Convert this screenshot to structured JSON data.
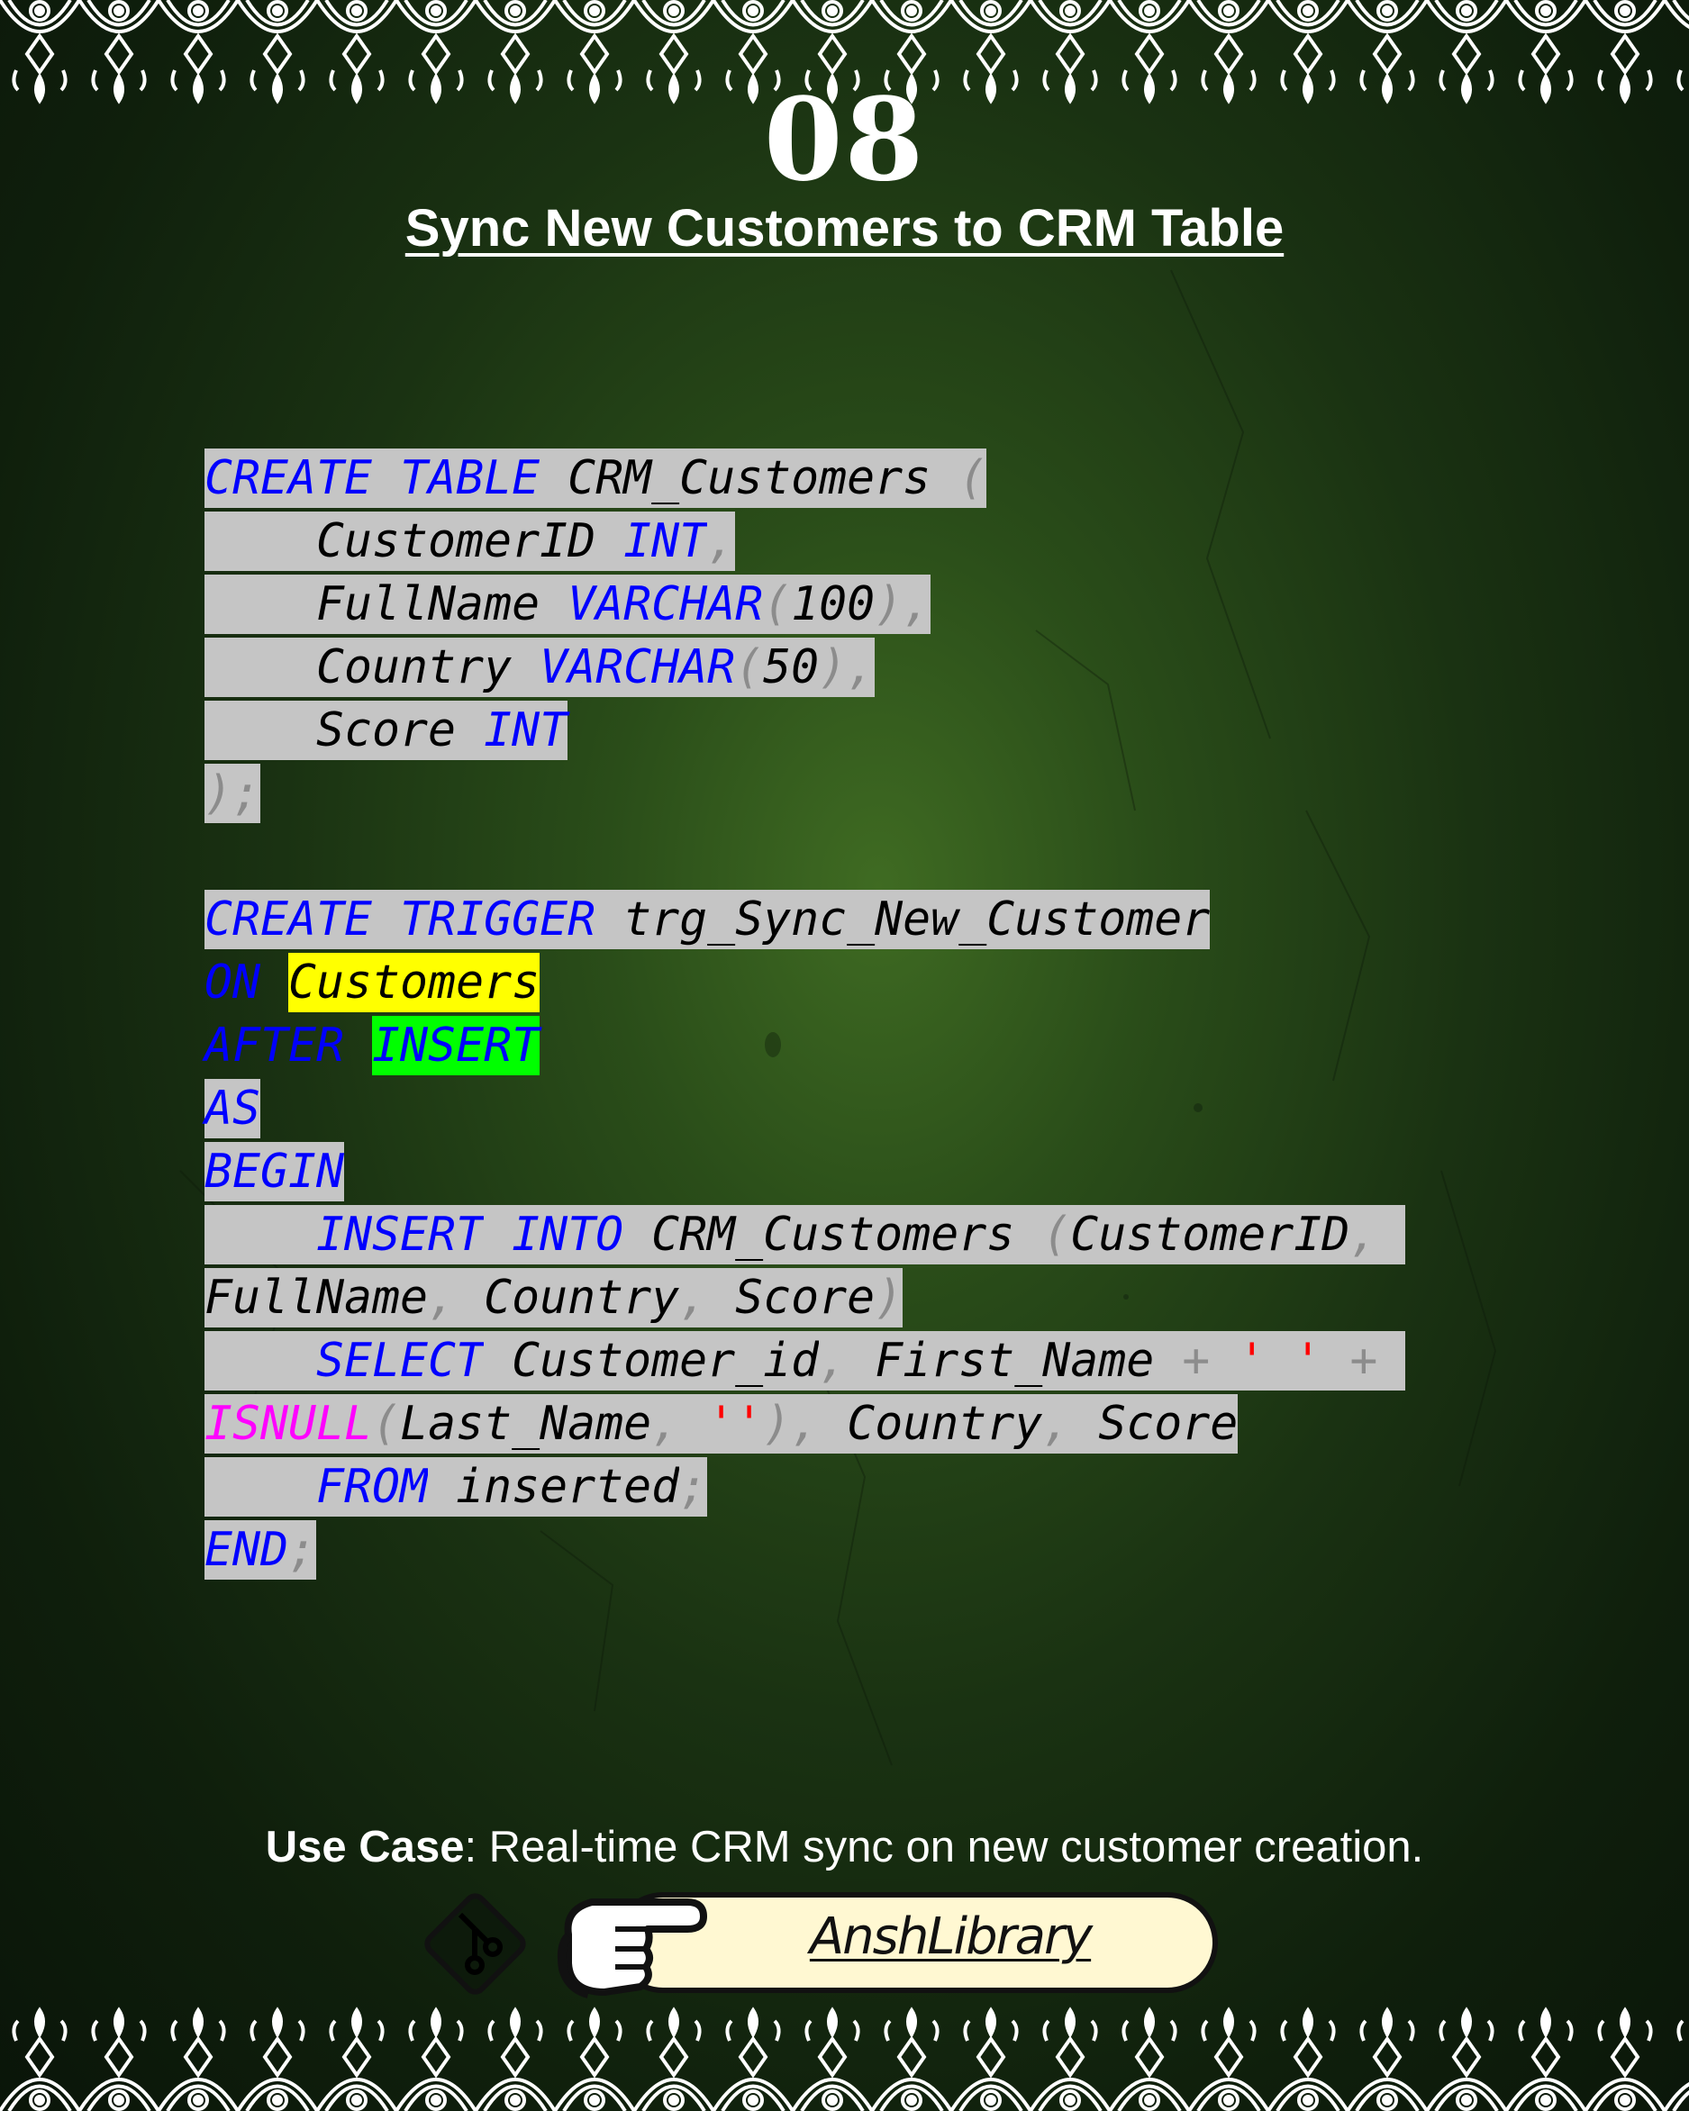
{
  "page_number": "08",
  "title": "Sync New Customers to CRM Table",
  "code_lines": [
    {
      "tokens": [
        [
          "kw",
          "CREATE",
          "bg"
        ],
        [
          "sp",
          " ",
          "bg"
        ],
        [
          "kw",
          "TABLE",
          "bg"
        ],
        [
          "sp",
          " ",
          "bg"
        ],
        [
          "id",
          "CRM_Customers",
          "bg"
        ],
        [
          "sp",
          " ",
          "bg"
        ],
        [
          "pn",
          "(",
          "bg"
        ]
      ]
    },
    {
      "tokens": [
        [
          "sp",
          "    ",
          "bg"
        ],
        [
          "id",
          "CustomerID",
          "bg"
        ],
        [
          "sp",
          " ",
          "bg"
        ],
        [
          "kw",
          "INT",
          "bg"
        ],
        [
          "pn",
          ",",
          "bg"
        ]
      ]
    },
    {
      "tokens": [
        [
          "sp",
          "    ",
          "bg"
        ],
        [
          "id",
          "FullName",
          "bg"
        ],
        [
          "sp",
          " ",
          "bg"
        ],
        [
          "kw",
          "VARCHAR",
          "bg"
        ],
        [
          "pn",
          "(",
          "bg"
        ],
        [
          "num",
          "100",
          "bg"
        ],
        [
          "pn",
          "),",
          "bg"
        ]
      ]
    },
    {
      "tokens": [
        [
          "sp",
          "    ",
          "bg"
        ],
        [
          "id",
          "Country",
          "bg"
        ],
        [
          "sp",
          " ",
          "bg"
        ],
        [
          "kw",
          "VARCHAR",
          "bg"
        ],
        [
          "pn",
          "(",
          "bg"
        ],
        [
          "num",
          "50",
          "bg"
        ],
        [
          "pn",
          "),",
          "bg"
        ]
      ]
    },
    {
      "tokens": [
        [
          "sp",
          "    ",
          "bg"
        ],
        [
          "id",
          "Score",
          "bg"
        ],
        [
          "sp",
          " ",
          "bg"
        ],
        [
          "kw",
          "INT",
          "bg"
        ]
      ]
    },
    {
      "tokens": [
        [
          "pn",
          ");",
          "bg"
        ]
      ]
    },
    {
      "tokens": []
    },
    {
      "tokens": [
        [
          "kw",
          "CREATE",
          "bg"
        ],
        [
          "sp",
          " ",
          "bg"
        ],
        [
          "kw",
          "TRIGGER",
          "bg"
        ],
        [
          "sp",
          " ",
          "bg"
        ],
        [
          "id",
          "trg_Sync_New_Customer",
          "bg"
        ]
      ]
    },
    {
      "tokens": [
        [
          "kw",
          "ON",
          ""
        ],
        [
          "sp",
          " ",
          ""
        ],
        [
          "id",
          "Customers",
          "hl-yellow"
        ]
      ]
    },
    {
      "tokens": [
        [
          "kw",
          "AFTER",
          ""
        ],
        [
          "sp",
          " ",
          ""
        ],
        [
          "kw",
          "INSERT",
          "hl-green"
        ]
      ]
    },
    {
      "tokens": [
        [
          "kw",
          "AS",
          "bg"
        ]
      ]
    },
    {
      "tokens": [
        [
          "kw",
          "BEGIN",
          "bg"
        ]
      ]
    },
    {
      "tokens": [
        [
          "sp",
          "    ",
          "bg"
        ],
        [
          "kw",
          "INSERT",
          "bg"
        ],
        [
          "sp",
          " ",
          "bg"
        ],
        [
          "kw",
          "INTO",
          "bg"
        ],
        [
          "sp",
          " ",
          "bg"
        ],
        [
          "id",
          "CRM_Customers",
          "bg"
        ],
        [
          "sp",
          " ",
          "bg"
        ],
        [
          "pn",
          "(",
          "bg"
        ],
        [
          "id",
          "CustomerID",
          "bg"
        ],
        [
          "pn",
          ",",
          "bg"
        ],
        [
          "sp",
          " ",
          "bg"
        ]
      ]
    },
    {
      "tokens": [
        [
          "id",
          "FullName",
          "bg"
        ],
        [
          "pn",
          ",",
          "bg"
        ],
        [
          "sp",
          " ",
          "bg"
        ],
        [
          "id",
          "Country",
          "bg"
        ],
        [
          "pn",
          ",",
          "bg"
        ],
        [
          "sp",
          " ",
          "bg"
        ],
        [
          "id",
          "Score",
          "bg"
        ],
        [
          "pn",
          ")",
          "bg"
        ]
      ]
    },
    {
      "tokens": [
        [
          "sp",
          "    ",
          "bg"
        ],
        [
          "kw",
          "SELECT",
          "bg"
        ],
        [
          "sp",
          " ",
          "bg"
        ],
        [
          "id",
          "Customer_id",
          "bg"
        ],
        [
          "pn",
          ",",
          "bg"
        ],
        [
          "sp",
          " ",
          "bg"
        ],
        [
          "id",
          "First_Name",
          "bg"
        ],
        [
          "sp",
          " ",
          "bg"
        ],
        [
          "pn",
          "+",
          "bg"
        ],
        [
          "sp",
          " ",
          "bg"
        ],
        [
          "str",
          "' '",
          "bg"
        ],
        [
          "sp",
          " ",
          "bg"
        ],
        [
          "pn",
          "+",
          "bg"
        ],
        [
          "sp",
          " ",
          "bg"
        ]
      ]
    },
    {
      "tokens": [
        [
          "fn",
          "ISNULL",
          "bg"
        ],
        [
          "pn",
          "(",
          "bg"
        ],
        [
          "id",
          "Last_Name",
          "bg"
        ],
        [
          "pn",
          ",",
          "bg"
        ],
        [
          "sp",
          " ",
          "bg"
        ],
        [
          "str",
          "''",
          "bg"
        ],
        [
          "pn",
          "),",
          "bg"
        ],
        [
          "sp",
          " ",
          "bg"
        ],
        [
          "id",
          "Country",
          "bg"
        ],
        [
          "pn",
          ",",
          "bg"
        ],
        [
          "sp",
          " ",
          "bg"
        ],
        [
          "id",
          "Score",
          "bg"
        ]
      ]
    },
    {
      "tokens": [
        [
          "sp",
          "    ",
          "bg"
        ],
        [
          "kw",
          "FROM",
          "bg"
        ],
        [
          "sp",
          " ",
          "bg"
        ],
        [
          "id",
          "inserted",
          "bg"
        ],
        [
          "pn",
          ";",
          "bg"
        ]
      ]
    },
    {
      "tokens": [
        [
          "kw",
          "END",
          "bg"
        ],
        [
          "pn",
          ";",
          "bg"
        ]
      ]
    }
  ],
  "use_case": {
    "label": "Use Case",
    "text": ": Real-time CRM sync on new customer creation."
  },
  "brand": {
    "name": "AnshLibrary",
    "icons": [
      "git-diamond-icon",
      "pointing-hand-icon"
    ]
  },
  "colors": {
    "keyword": "#0000ff",
    "identifier": "#000000",
    "punctuation": "#8c8c8c",
    "string": "#ff0000",
    "function": "#ff00ff",
    "code_background": "#c5c5c5",
    "highlight_yellow": "#ffff00",
    "highlight_green": "#00ff00",
    "brand_pill": "#fff8d2"
  }
}
